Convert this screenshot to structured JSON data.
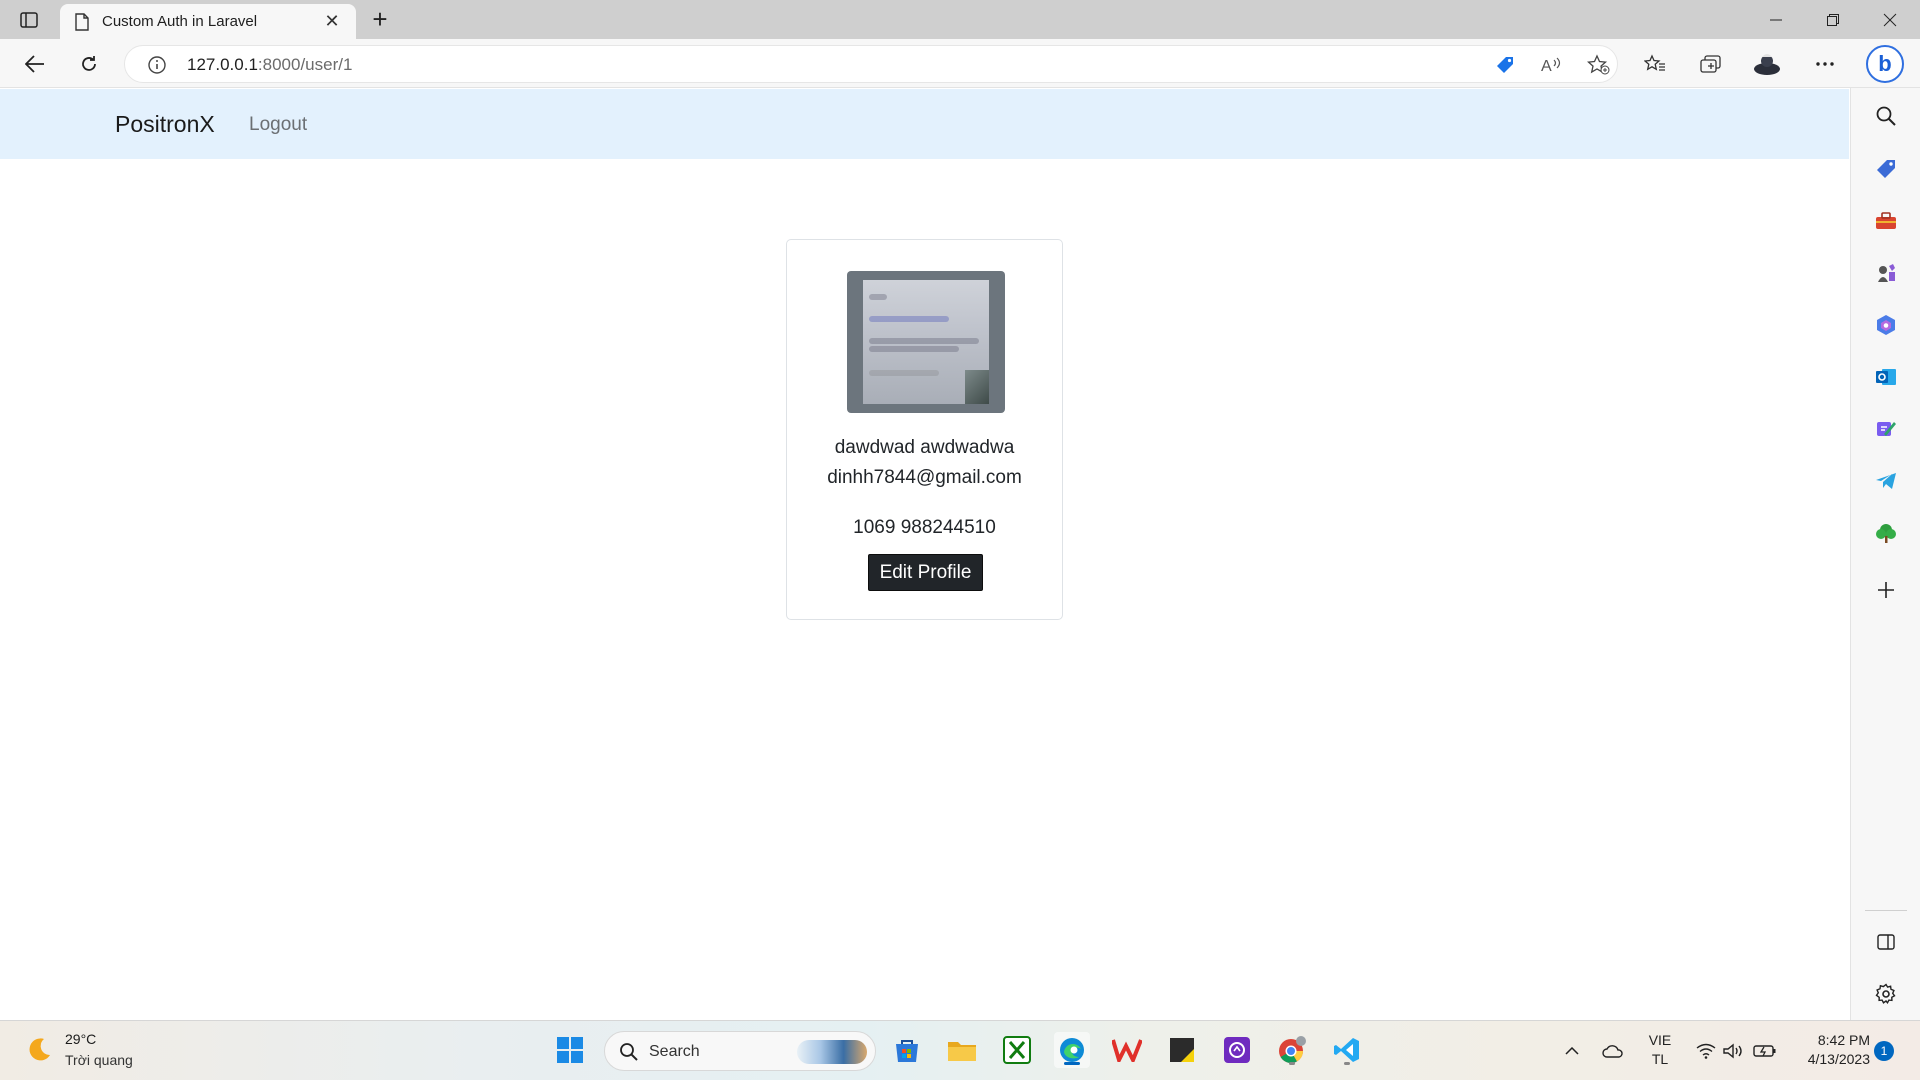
{
  "browser": {
    "tab_title": "Custom Auth in Laravel",
    "url_host": "127.0.0.1",
    "url_rest": ":8000/user/1",
    "icons": [
      "sidebar-toggle-icon",
      "page-icon",
      "close-icon",
      "plus-icon",
      "back-icon",
      "refresh-icon",
      "info-icon",
      "shopping-tag-icon",
      "read-aloud-icon",
      "add-favorite-icon",
      "favorites-icon",
      "collections-icon",
      "profile-icon",
      "more-icon",
      "bing-icon"
    ],
    "bing_label": "b"
  },
  "sidebar": {
    "icons": [
      "search-icon",
      "shopping-icon",
      "tools-icon",
      "games-icon",
      "office-icon",
      "outlook-icon",
      "designer-icon",
      "telegram-icon",
      "tree-icon",
      "add-icon",
      "split-screen-icon",
      "settings-icon"
    ]
  },
  "navbar": {
    "brand": "PositronX",
    "logout": "Logout",
    "background": "#e3f1fd"
  },
  "profile": {
    "name": "dawdwad awdwadwa",
    "email": "dinhh7844@gmail.com",
    "phone": "1069 988244510",
    "edit_button": "Edit Profile"
  },
  "taskbar": {
    "weather_temp": "29°C",
    "weather_desc": "Trời quang",
    "search_label": "Search",
    "lang_line1": "VIE",
    "lang_line2": "TL",
    "time": "8:42 PM",
    "date": "4/13/2023",
    "notification_count": "1",
    "apps": [
      "windows-start-icon",
      "microsoft-store-icon",
      "file-explorer-icon",
      "xbox-icon",
      "edge-icon",
      "wps-office-icon",
      "sticky-notes-icon",
      "photo-app-icon",
      "chrome-icon",
      "vscode-icon"
    ]
  }
}
